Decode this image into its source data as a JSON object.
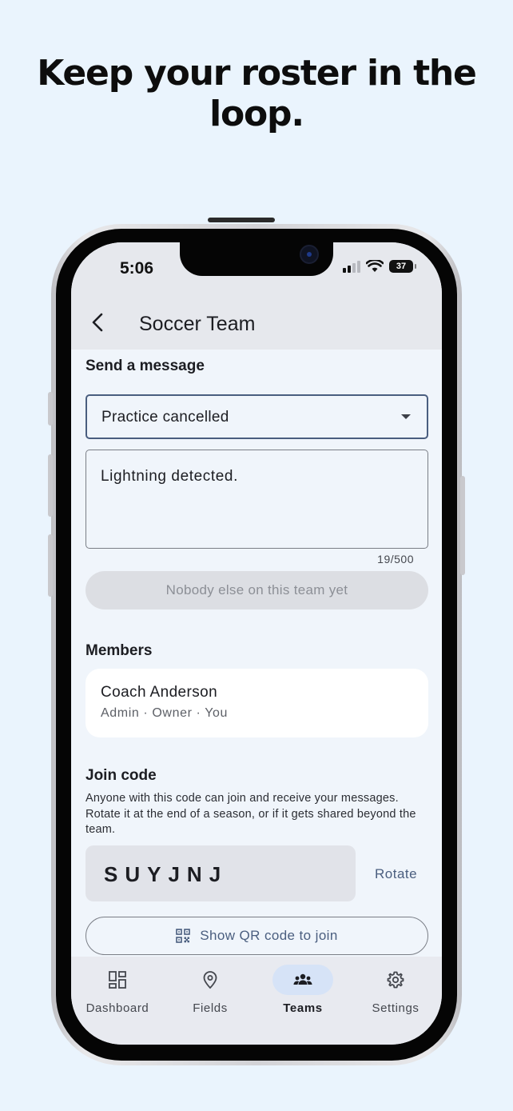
{
  "headline": "Keep your roster in the loop.",
  "status_bar": {
    "time": "5:06",
    "battery": "37"
  },
  "app_bar": {
    "title": "Soccer Team"
  },
  "send_message": {
    "title": "Send a message",
    "template_selected": "Practice cancelled",
    "message_text": "Lightning detected.",
    "char_count": "19/500",
    "send_button_label": "Nobody else on this team yet"
  },
  "members": {
    "title": "Members",
    "items": [
      {
        "name": "Coach Anderson",
        "roles": "Admin · Owner · You"
      }
    ]
  },
  "join_code": {
    "title": "Join code",
    "description": "Anyone with this code can join and receive your messages. Rotate it at the end of a season, or if it gets shared beyond the team.",
    "code": "SUYJNJ",
    "rotate_label": "Rotate",
    "qr_button_label": "Show QR code to join"
  },
  "bottom_nav": {
    "items": [
      {
        "label": "Dashboard",
        "icon": "dashboard-icon",
        "active": false
      },
      {
        "label": "Fields",
        "icon": "location-pin-icon",
        "active": false
      },
      {
        "label": "Teams",
        "icon": "groups-icon",
        "active": true
      },
      {
        "label": "Settings",
        "icon": "gear-icon",
        "active": false
      }
    ]
  },
  "colors": {
    "background": "#eaf4fd",
    "accent": "#4a5e7f",
    "active_nav_pill": "#d6e3f7"
  }
}
